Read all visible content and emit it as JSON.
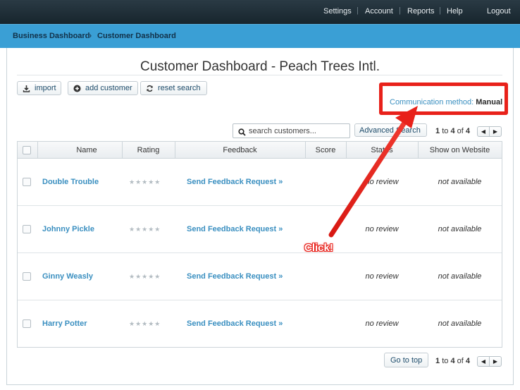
{
  "topnav": {
    "items": [
      "Settings",
      "Account",
      "Reports",
      "Help"
    ],
    "separator": "|",
    "logout": "Logout"
  },
  "breadcrumb": {
    "items": [
      "Business Dashboard",
      "Customer Dashboard"
    ],
    "separator": "»"
  },
  "page_title": "Customer Dashboard - Peach Trees Intl.",
  "toolbar": {
    "import_label": "import",
    "add_customer_label": "add customer",
    "reset_search_label": "reset search"
  },
  "communication": {
    "label": "Communication method:",
    "value": "Manual"
  },
  "search": {
    "placeholder": "search customers...",
    "advanced_label": "Advanced Search"
  },
  "pager": {
    "from": "1",
    "to_word": "to",
    "to": "4",
    "of_word": "of",
    "total": "4"
  },
  "table": {
    "columns": [
      "Name",
      "Rating",
      "Feedback",
      "Score",
      "Status",
      "Show on Website"
    ],
    "rows": [
      {
        "name": "Double Trouble",
        "rating": "★★★★★",
        "feedback": "Send Feedback Request »",
        "score": "",
        "status": "no review",
        "show": "not available"
      },
      {
        "name": "Johnny Pickle",
        "rating": "★★★★★",
        "feedback": "Send Feedback Request »",
        "score": "",
        "status": "no review",
        "show": "not available"
      },
      {
        "name": "Ginny Weasly",
        "rating": "★★★★★",
        "feedback": "Send Feedback Request »",
        "score": "",
        "status": "no review",
        "show": "not available"
      },
      {
        "name": "Harry Potter",
        "rating": "★★★★★",
        "feedback": "Send Feedback Request »",
        "score": "",
        "status": "no review",
        "show": "not available"
      }
    ]
  },
  "footer": {
    "go_to_top_label": "Go to top"
  },
  "annotation": {
    "click_label": "Click!",
    "color": "#e8211a"
  },
  "colors": {
    "topbar": "#1d2c35",
    "breadcrumb_bar": "#3a9fd5",
    "link": "#3a8fc0"
  }
}
